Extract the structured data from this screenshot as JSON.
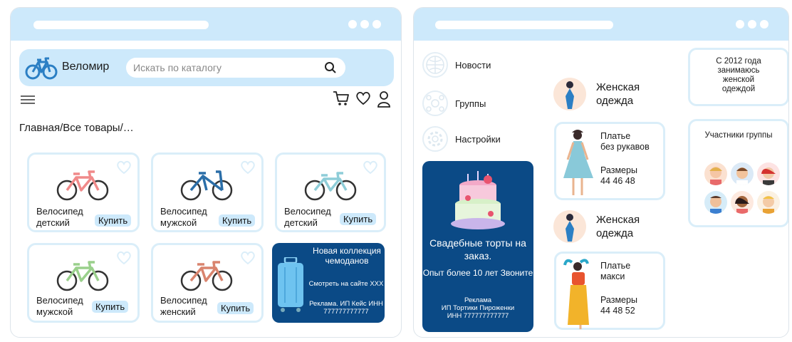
{
  "left_window": {
    "brand": "Веломир",
    "search": {
      "placeholder": "Искать по каталогу"
    },
    "breadcrumb": "Главная/Все товары/…",
    "products": [
      {
        "name": "Велосипед\nдетский",
        "buy": "Купить",
        "color": "#f08a8a"
      },
      {
        "name": "Велосипед\nмужской",
        "buy": "Купить",
        "color": "#2b6ea8"
      },
      {
        "name": "Велосипед\nдетский",
        "buy": "Купить",
        "color": "#8ecdd8"
      },
      {
        "name": "Велосипед\nмужской",
        "buy": "Купить",
        "color": "#9ad08c"
      },
      {
        "name": "Велосипед\nженский",
        "buy": "Купить",
        "color": "#d9846e"
      }
    ],
    "ad": {
      "title": "Новая коллекция чемоданов",
      "sub": "Смотреть на сайте XXX",
      "rekl": "Реклама. ИП Кейс ИНН 777777777777"
    }
  },
  "right_window": {
    "nav": [
      "Новости",
      "Группы",
      "Настройки"
    ],
    "ad": {
      "title": "Свадебные торты на заказ.",
      "sub": "Опыт более 10 лет Звоните",
      "rekl": "Реклама\nИП Тортики Пироженки\nИНН 777777777777"
    },
    "group_title": "Женская\nодежда",
    "posts": [
      {
        "name": "Платье\nбез рукавов",
        "sizes": "Размеры\n44 46 48"
      },
      {
        "name": "Платье\nмакси",
        "sizes": "Размеры\n44 48 52"
      }
    ],
    "about": "С 2012 года\nзанимаюсь\nженской\nодеждой",
    "members_title": "Участники группы"
  },
  "colors": {
    "accent": "#cde9fb",
    "ad_bg": "#0b4a86",
    "card_border": "#daeef9"
  }
}
